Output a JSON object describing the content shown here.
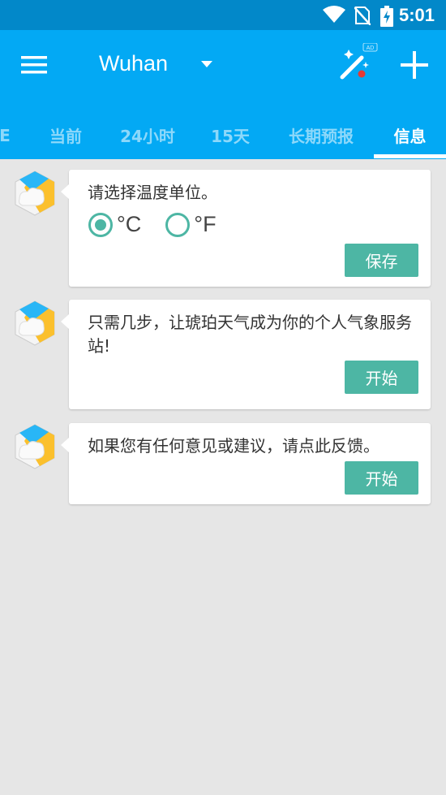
{
  "status_bar": {
    "time": "5:01"
  },
  "app_bar": {
    "city": "Wuhan",
    "ad_badge": "AD",
    "tabs": [
      {
        "label": "E"
      },
      {
        "label": "当前"
      },
      {
        "label": "24小时"
      },
      {
        "label": "15天"
      },
      {
        "label": "长期预报"
      },
      {
        "label": "信息"
      }
    ],
    "active_tab": "信息",
    "accent_color": "#03a9f4"
  },
  "messages": [
    {
      "text": "请选择温度单位。",
      "units": [
        {
          "label": "°C",
          "checked": true
        },
        {
          "label": "°F",
          "checked": false
        }
      ],
      "button": "保存"
    },
    {
      "text": "只需几步，让琥珀天气成为你的个人气象服务站!",
      "button": "开始"
    },
    {
      "text": "如果您有任何意见或建议，请点此反馈。",
      "button": "开始"
    }
  ],
  "button_color": "#4db6a4"
}
